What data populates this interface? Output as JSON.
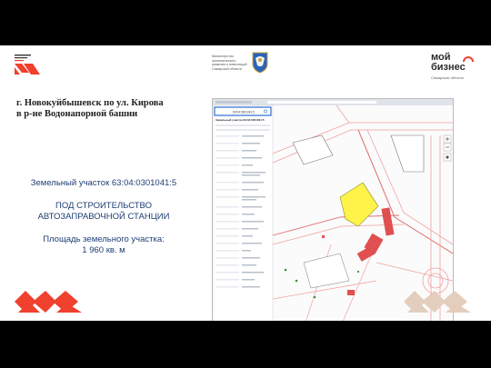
{
  "header": {
    "gov_text_lines": [
      "Министерство",
      "экономического",
      "развития и инвестиций",
      "Самарской области"
    ],
    "brand_line1": "мой",
    "brand_line2": "бизнес",
    "brand_sub": "Самарская область"
  },
  "heading": {
    "line1": "г. Новокуйбышевск по ул. Кирова",
    "line2": "в р-не Водонапорной башни"
  },
  "parcel": {
    "cadastral": "Земельный участок 63:04:0301041:5",
    "purpose_line1": "ПОД СТРОИТЕЛЬСТВО",
    "purpose_line2": "АВТОЗАПРАВОЧНОЙ СТАНЦИИ",
    "area_label": "Площадь земельного участка:",
    "area_value": "1 960 кв. м"
  },
  "map": {
    "search_value": "63:04:0301041:5",
    "panel_title": "Земельный участок 63:04:0301041:5",
    "highlight_color": "#fff34a",
    "building_color": "#e05050",
    "road_color": "#f2a0a0",
    "accent_color": "#2a6fd6"
  },
  "colors": {
    "brand_red": "#f0402e",
    "deco_beige": "#e3cdbd",
    "text_blue": "#1f3f74"
  },
  "icons": [
    "logo-icon",
    "emblem-icon",
    "brand-arc-icon",
    "search-icon",
    "zoom-in-icon",
    "zoom-out-icon",
    "layers-icon"
  ]
}
